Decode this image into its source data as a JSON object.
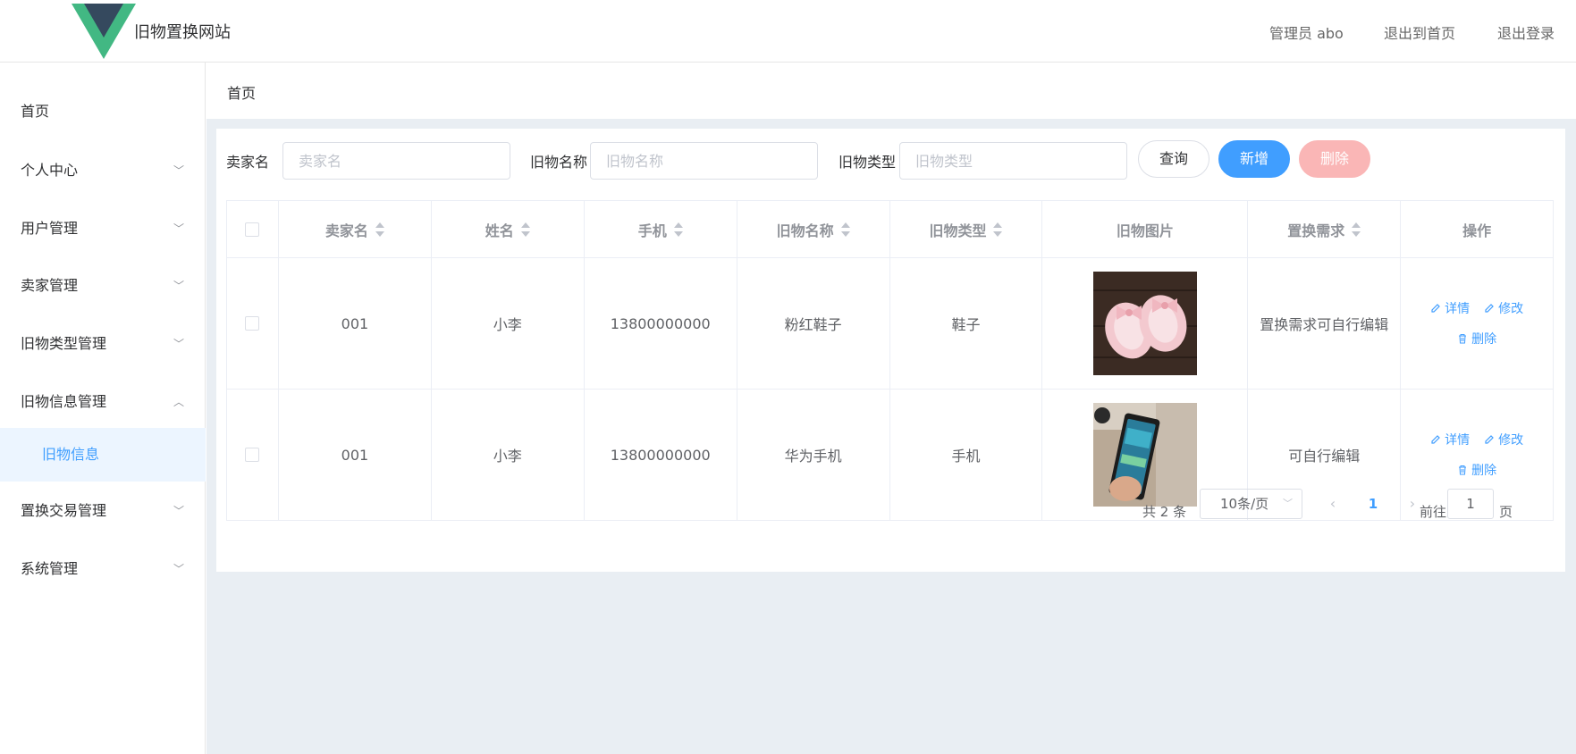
{
  "header": {
    "site_title": "旧物置换网站",
    "admin_label": "管理员 abo",
    "back_home": "退出到首页",
    "logout": "退出登录",
    "logo_colors": {
      "outer": "#42b883",
      "inner": "#35495e"
    }
  },
  "sidebar": {
    "items": [
      {
        "label": "首页",
        "expandable": false
      },
      {
        "label": "个人中心",
        "expandable": true,
        "expanded": false
      },
      {
        "label": "用户管理",
        "expandable": true,
        "expanded": false
      },
      {
        "label": "卖家管理",
        "expandable": true,
        "expanded": false
      },
      {
        "label": "旧物类型管理",
        "expandable": true,
        "expanded": false
      },
      {
        "label": "旧物信息管理",
        "expandable": true,
        "expanded": true
      },
      {
        "label": "置换交易管理",
        "expandable": true,
        "expanded": false
      },
      {
        "label": "系统管理",
        "expandable": true,
        "expanded": false
      }
    ],
    "active_subitem": "旧物信息"
  },
  "breadcrumb": "首页",
  "filters": {
    "seller_label": "卖家名",
    "seller_placeholder": "卖家名",
    "item_name_label": "旧物名称",
    "item_name_placeholder": "旧物名称",
    "item_type_label": "旧物类型",
    "item_type_placeholder": "旧物类型",
    "query_button": "查询",
    "add_button": "新增",
    "delete_button": "删除"
  },
  "table": {
    "headers": [
      "卖家名",
      "姓名",
      "手机",
      "旧物名称",
      "旧物类型",
      "旧物图片",
      "置换需求",
      "操作"
    ],
    "rows": [
      {
        "seller": "001",
        "name": "小李",
        "phone": "13800000000",
        "item_name": "粉红鞋子",
        "item_type": "鞋子",
        "image_icon": "pink-shoes-photo",
        "demand": "置换需求可自行编辑"
      },
      {
        "seller": "001",
        "name": "小李",
        "phone": "13800000000",
        "item_name": "华为手机",
        "item_type": "手机",
        "image_icon": "phone-photo",
        "demand": "可自行编辑"
      }
    ],
    "actions": {
      "detail": "详情",
      "edit": "修改",
      "delete": "删除"
    }
  },
  "pagination": {
    "total": "共 2 条",
    "page_size": "10条/页",
    "current_page": "1",
    "goto_prefix": "前往",
    "goto_value": "1",
    "goto_suffix": "页"
  },
  "colors": {
    "primary": "#409eff",
    "danger_disabled": "#fab6b6",
    "main_bg": "#e9eef3"
  }
}
